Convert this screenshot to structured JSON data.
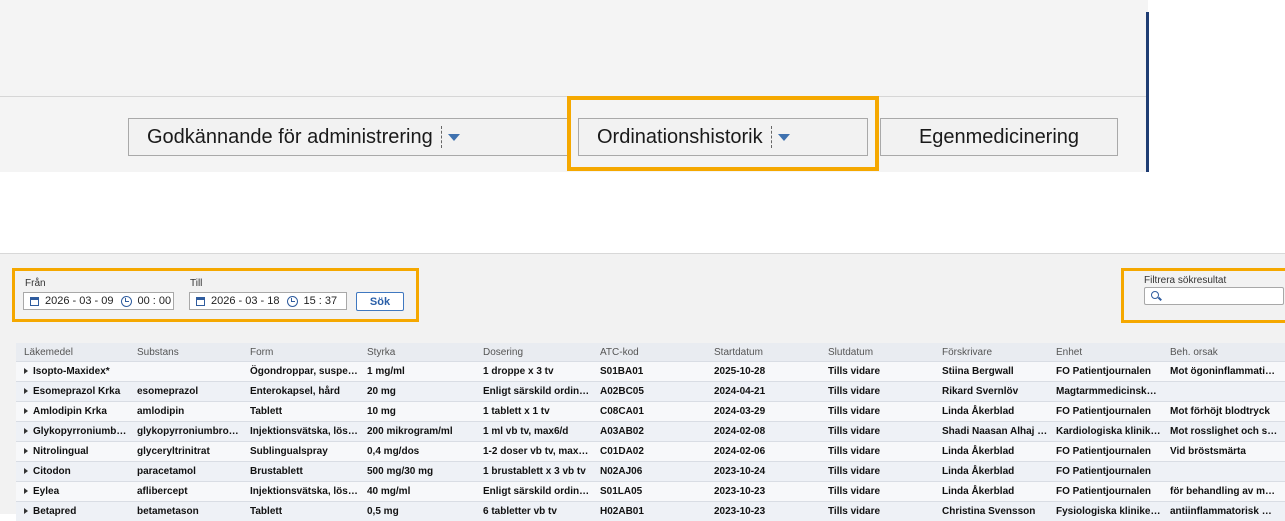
{
  "toolbar": {
    "tabs": [
      {
        "label": "Godkännande för administrering"
      },
      {
        "label": "Ordinationshistorik"
      },
      {
        "label": "Egenmedicinering"
      }
    ]
  },
  "filters": {
    "from_label": "Från",
    "from_date": "2026 - 03 - 09",
    "from_time": "00 : 00",
    "to_label": "Till",
    "to_date": "2026 - 03 - 18",
    "to_time": "15 : 37",
    "search_button": "Sök",
    "result_filter_label": "Filtrera sökresultat",
    "result_filter_value": ""
  },
  "table": {
    "columns": [
      "Läkemedel",
      "Substans",
      "Form",
      "Styrka",
      "Dosering",
      "ATC-kod",
      "Startdatum",
      "Slutdatum",
      "Förskrivare",
      "Enhet",
      "Beh. orsak"
    ],
    "rows": [
      [
        "Isopto-Maxidex*",
        "",
        "Ögondroppar, suspe…",
        "1 mg/ml",
        "1 droppe x 3 tv",
        "S01BA01",
        "2025-10-28",
        "Tills vidare",
        "Stiina Bergwall",
        "FO Patientjournalen",
        "Mot ögoninflammati…"
      ],
      [
        "Esomeprazol Krka",
        "esomeprazol",
        "Enterokapsel, hård",
        "20 mg",
        "Enligt särskild ordin…",
        "A02BC05",
        "2024-04-21",
        "Tills vidare",
        "Rikard Svernlöv",
        "Magtarmmedicinska…",
        ""
      ],
      [
        "Amlodipin Krka",
        "amlodipin",
        "Tablett",
        "10 mg",
        "1 tablett x 1 tv",
        "C08CA01",
        "2024-03-29",
        "Tills vidare",
        "Linda Åkerblad",
        "FO Patientjournalen",
        "Mot förhöjt blodtryck"
      ],
      [
        "Glykopyrroniumb…",
        "glykopyrroniumbro…",
        "Injektionsvätska, lös…",
        "200 mikrogram/ml",
        "1 ml vb tv, max6/d",
        "A03AB02",
        "2024-02-08",
        "Tills vidare",
        "Shadi Naasan Alhaj …",
        "Kardiologiska klinik…",
        "Mot rosslighet och s…"
      ],
      [
        "Nitrolingual",
        "glyceryltrinitrat",
        "Sublingualspray",
        "0,4 mg/dos",
        "1-2 doser vb tv, max…",
        "C01DA02",
        "2024-02-06",
        "Tills vidare",
        "Linda Åkerblad",
        "FO Patientjournalen",
        "Vid bröstsmärta"
      ],
      [
        "Citodon",
        "paracetamol",
        "Brustablett",
        "500 mg/30 mg",
        "1 brustablett x 3 vb tv",
        "N02AJ06",
        "2023-10-24",
        "Tills vidare",
        "Linda Åkerblad",
        "FO Patientjournalen",
        ""
      ],
      [
        "Eylea",
        "aflibercept",
        "Injektionsvätska, lös…",
        "40 mg/ml",
        "Enligt särskild ordin…",
        "S01LA05",
        "2023-10-23",
        "Tills vidare",
        "Linda Åkerblad",
        "FO Patientjournalen",
        "för behandling av m…"
      ],
      [
        "Betapred",
        "betametason",
        "Tablett",
        "0,5 mg",
        "6 tabletter vb tv",
        "H02AB01",
        "2023-10-23",
        "Tills vidare",
        "Christina Svensson",
        "Fysiologiska klinike…",
        "antiinflammatorisk …"
      ]
    ]
  },
  "colors": {
    "highlight": "#f5a800",
    "accent": "#2f5c9e",
    "divider_bar": "#1f3d73"
  }
}
